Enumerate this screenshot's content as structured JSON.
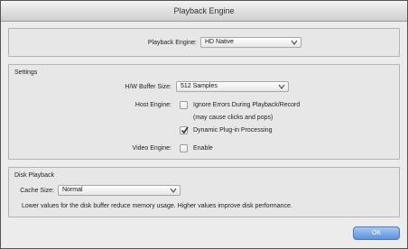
{
  "window": {
    "title": "Playback Engine"
  },
  "engine": {
    "label": "Playback Engine:",
    "value": "HD Native"
  },
  "settings": {
    "heading": "Settings",
    "buffer_label": "H/W Buffer Size:",
    "buffer_value": "512 Samples",
    "host_label": "Host Engine:",
    "ignore_errors_label": "Ignore Errors During Playback/Record",
    "ignore_errors_note": "(may cause clicks and pops)",
    "dynamic_plugin_label": "Dynamic Plug-in Processing",
    "video_label": "Video Engine:",
    "enable_label": "Enable",
    "ignore_errors_checked": false,
    "dynamic_plugin_checked": true,
    "video_enable_checked": false
  },
  "disk": {
    "heading": "Disk Playback",
    "cache_label": "Cache Size:",
    "cache_value": "Normal",
    "note": "Lower values for the disk buffer reduce memory usage.  Higher values improve disk performance."
  },
  "buttons": {
    "ok": "OK"
  },
  "colors": {
    "accent": "#5e92dd",
    "check": "#2f2f2f"
  }
}
